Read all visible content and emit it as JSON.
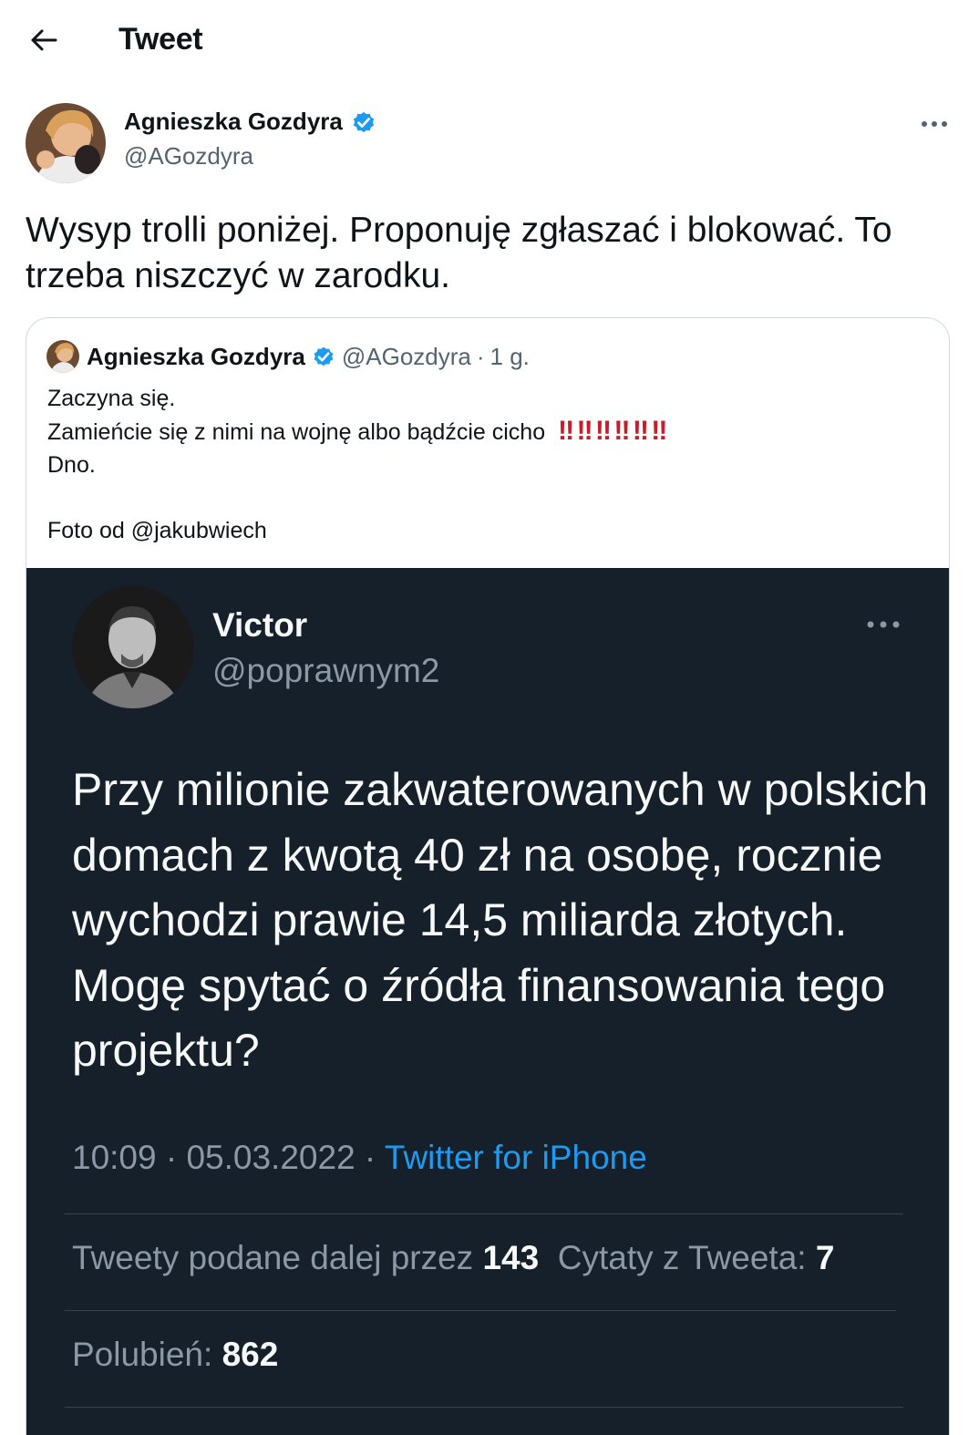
{
  "header": {
    "title": "Tweet",
    "back_icon": "arrow-left-icon"
  },
  "tweet": {
    "author_name": "Agnieszka Gozdyra",
    "author_handle": "@AGozdyra",
    "verified_icon": "verified-badge-icon",
    "more_icon": "more-horizontal-icon",
    "text": "Wysyp trolli poniżej. Proponuję zgłaszać i blokować. To trzeba niszczyć w zarodku."
  },
  "quoted": {
    "author_name": "Agnieszka Gozdyra",
    "author_handle": "@AGozdyra",
    "separator": "·",
    "time": "1 g.",
    "line1": "Zaczyna się.",
    "line2": "Zamieńcie się z nimi na wojnę albo bądźcie cicho",
    "bangs": "‼ ‼ ‼ ‼ ‼ ‼",
    "line3": "Dno.",
    "line4": "Foto od @jakubwiech"
  },
  "screenshot": {
    "name": "Victor",
    "handle": "@poprawnym2",
    "text": "Przy milionie zakwaterowanych w polskich domach z kwotą 40 zł na osobę, rocznie wychodzi prawie 14,5 miliarda złotych. Mogę spytać o źródła finansowania tego projektu?",
    "time": "10:09 · 05.03.2022 ·",
    "source": "Twitter for iPhone",
    "retweets_label": "Tweety podane dalej przez",
    "retweets_count": "143",
    "quotes_label": "Cytaty z Tweeta:",
    "quotes_count": "7",
    "likes_label": "Polubień:",
    "likes_count": "862"
  },
  "colors": {
    "accent": "#1d9bf0",
    "dark_bg": "#15202b",
    "muted": "#536471"
  }
}
